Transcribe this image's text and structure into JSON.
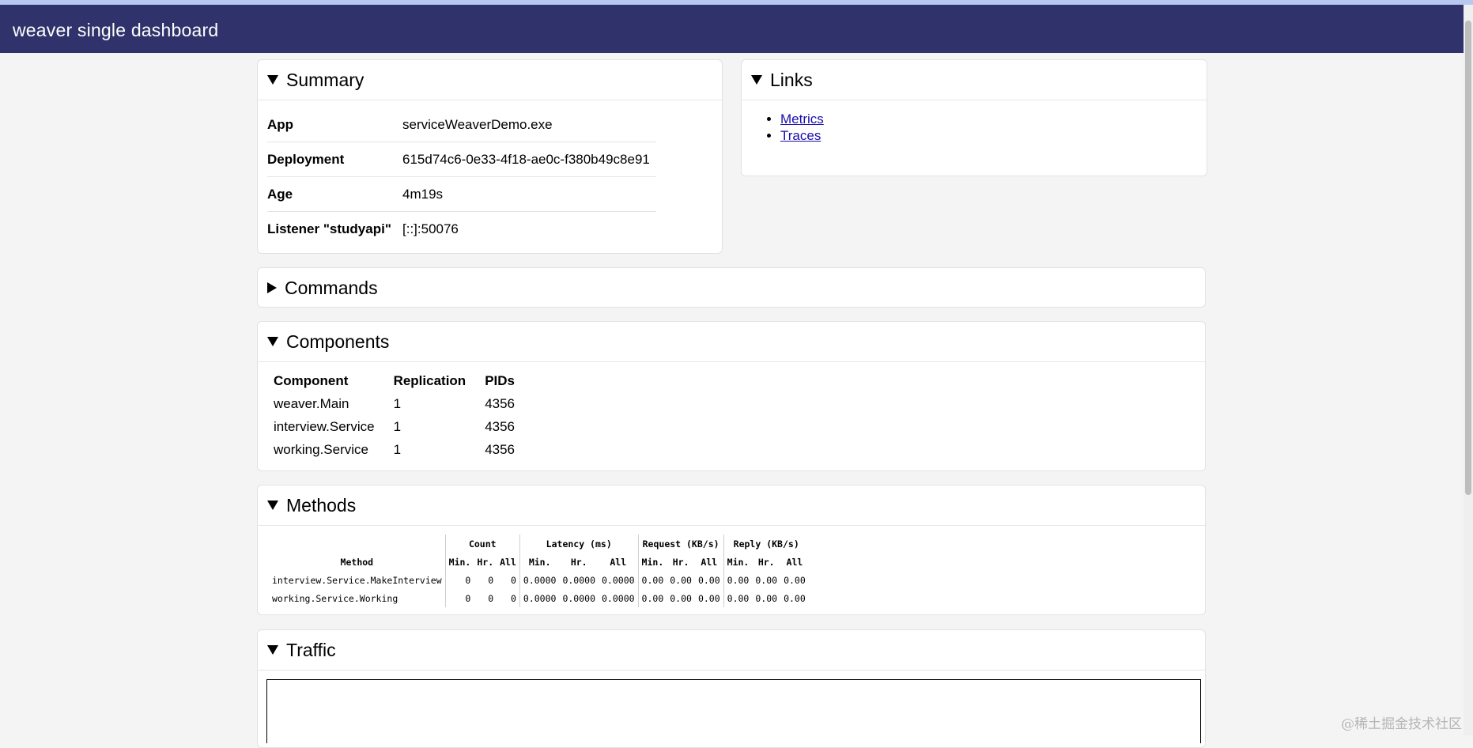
{
  "header": {
    "title": "weaver single dashboard"
  },
  "summary": {
    "title": "Summary",
    "rows": [
      {
        "key": "App",
        "value": "serviceWeaverDemo.exe"
      },
      {
        "key": "Deployment",
        "value": "615d74c6-0e33-4f18-ae0c-f380b49c8e91"
      },
      {
        "key": "Age",
        "value": "4m19s"
      },
      {
        "key": "Listener \"studyapi\"",
        "value": "[::]:50076"
      }
    ]
  },
  "links": {
    "title": "Links",
    "items": [
      "Metrics",
      "Traces"
    ]
  },
  "commands": {
    "title": "Commands"
  },
  "components": {
    "title": "Components",
    "headers": [
      "Component",
      "Replication",
      "PIDs"
    ],
    "rows": [
      [
        "weaver.Main",
        "1",
        "4356"
      ],
      [
        "interview.Service",
        "1",
        "4356"
      ],
      [
        "working.Service",
        "1",
        "4356"
      ]
    ]
  },
  "methods": {
    "title": "Methods",
    "group_headers": [
      "Count",
      "Latency (ms)",
      "Request (KB/s)",
      "Reply (KB/s)"
    ],
    "method_header": "Method",
    "sub_headers": [
      "Min.",
      "Hr.",
      "All"
    ],
    "rows": [
      {
        "name": "interview.Service.MakeInterview",
        "values": [
          "0",
          "0",
          "0",
          "0.0000",
          "0.0000",
          "0.0000",
          "0.00",
          "0.00",
          "0.00",
          "0.00",
          "0.00",
          "0.00"
        ]
      },
      {
        "name": "working.Service.Working",
        "values": [
          "0",
          "0",
          "0",
          "0.0000",
          "0.0000",
          "0.0000",
          "0.00",
          "0.00",
          "0.00",
          "0.00",
          "0.00",
          "0.00"
        ]
      }
    ]
  },
  "traffic": {
    "title": "Traffic"
  },
  "watermark": "@稀土掘金技术社区"
}
